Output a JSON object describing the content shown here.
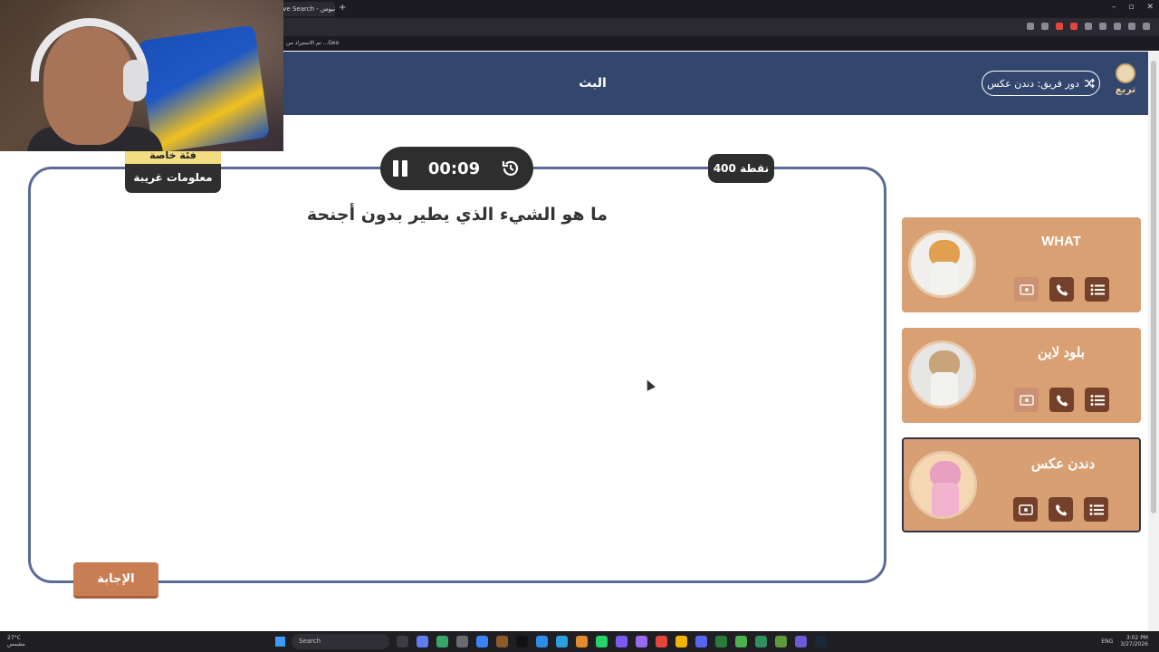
{
  "browser": {
    "tab_title": "ave Search - اونيوس",
    "new_tab": "+",
    "window_controls": [
      "–",
      "▫",
      "✕"
    ],
    "bookmark": "تم الاستيراد من ...Geo"
  },
  "header": {
    "title": "البث",
    "turn_label": "دور فريق: دندن عكس",
    "logo_text": "تربع"
  },
  "game": {
    "category_special": "فئة خاصة",
    "category_name": "معلومات غريبة",
    "timer": "00:09",
    "points": "400 نقطة",
    "question": "ما هو الشيء الذي يطير بدون أجنحة",
    "answer_button": "الإجابة"
  },
  "teams": [
    {
      "name": "WHAT",
      "avatar": "cat-avatar",
      "active": false,
      "tools": [
        "double-points-icon",
        "phone-icon",
        "list-icon"
      ],
      "tools_used": [
        true,
        false,
        false
      ]
    },
    {
      "name": "بلود لاين",
      "avatar": "horse-avatar",
      "active": false,
      "tools": [
        "double-points-icon",
        "phone-icon",
        "list-icon"
      ],
      "tools_used": [
        true,
        false,
        false
      ]
    },
    {
      "name": "دندن عكس",
      "avatar": "pink-cat-avatar",
      "active": true,
      "tools": [
        "double-points-icon",
        "phone-icon",
        "list-icon"
      ],
      "tools_used": [
        false,
        false,
        false
      ]
    }
  ],
  "taskbar": {
    "weather_temp": "27°C",
    "weather_desc": "مشمس",
    "search_placeholder": "Search",
    "lang": "ENG",
    "time": "3:02 PM",
    "date": "3/27/2026"
  },
  "colors": {
    "header_bg": "#33466e",
    "frame_border": "#5a6b95",
    "team_bg": "#d9a073",
    "tool_bg": "#74402a",
    "answer_bg": "#c97d53",
    "category_tag": "#f3dd83"
  }
}
